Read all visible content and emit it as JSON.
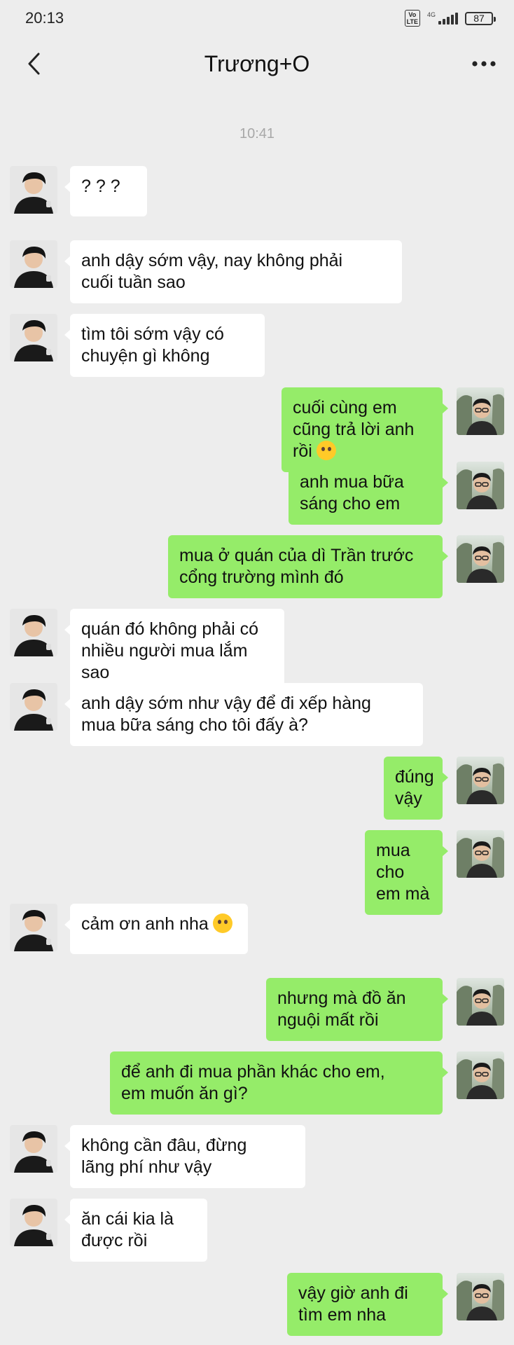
{
  "status": {
    "time": "20:13",
    "volte": "Vo\nLTE",
    "network": "4G",
    "battery": "87"
  },
  "header": {
    "title": "Trương+O",
    "back_icon": "chevron-left-icon",
    "more_icon": "more-horizontal-icon"
  },
  "chat": {
    "timestamp": "10:41",
    "messages": [
      {
        "side": "in",
        "text": "? ? ?"
      },
      {
        "side": "in",
        "text": "anh dậy sớm vậy, nay không phải\ncuối tuần sao"
      },
      {
        "side": "in",
        "text": "tìm tôi sớm vậy có\nchuyện gì không"
      },
      {
        "side": "out",
        "text": "cuối cùng em\ncũng trả lời anh rồi",
        "emoji": "pleading-face"
      },
      {
        "side": "out",
        "text": "anh mua bữa\nsáng cho em"
      },
      {
        "side": "out",
        "text": "mua ở quán của dì Trần trước\ncổng trường mình đó"
      },
      {
        "side": "in",
        "text": "quán đó không phải có\nnhiều người mua lắm sao"
      },
      {
        "side": "in",
        "text": "anh dậy sớm như vậy để đi xếp hàng\nmua bữa sáng cho tôi đấy à?"
      },
      {
        "side": "out",
        "text": "đúng vậy"
      },
      {
        "side": "out",
        "text": "mua cho\nem mà"
      },
      {
        "side": "in",
        "text": "cảm ơn anh nha",
        "emoji": "grinning-sweat-face"
      },
      {
        "side": "out",
        "text": "nhưng mà đồ ăn\nnguội mất rồi"
      },
      {
        "side": "out",
        "text": "để anh đi mua phần khác cho em,\nem muốn ăn gì?"
      },
      {
        "side": "in",
        "text": "không cần đâu, đừng\nlãng phí như vậy"
      },
      {
        "side": "in",
        "text": "ăn cái kia là\nđược rồi"
      },
      {
        "side": "out",
        "text": "vậy giờ anh đi\ntìm em nha"
      }
    ]
  },
  "colors": {
    "background": "#ededed",
    "incoming_bubble": "#ffffff",
    "outgoing_bubble": "#95ec69",
    "timestamp": "#a8a8a8"
  }
}
